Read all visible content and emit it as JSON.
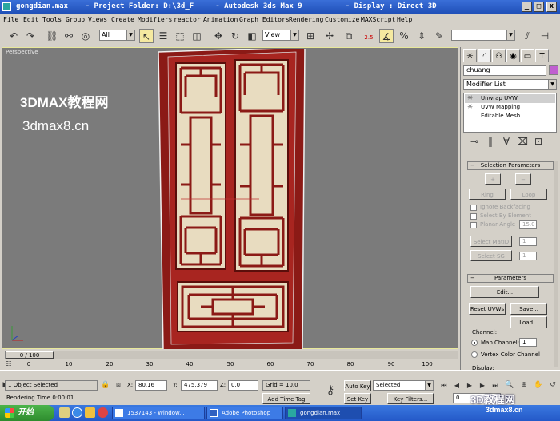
{
  "window": {
    "title": "gongdian.max    - Project Folder: D:\\3d_F     - Autodesk 3ds Max 9          - Display : Direct 3D",
    "min_glyph": "_",
    "max_glyph": "□",
    "close_glyph": "x"
  },
  "menu": [
    "File",
    "Edit",
    "Tools",
    "Group",
    "Views",
    "Create",
    "Modifiers",
    "reactor",
    "Animation",
    "Graph Editors",
    "Rendering",
    "Customize",
    "MAXScript",
    "Help"
  ],
  "toolbar": {
    "selection_filter": "All",
    "reference_coord": "View",
    "snap_value": "2.5"
  },
  "viewport": {
    "label": "Perspective",
    "watermark_title": "3DMAX教程网",
    "watermark_url": "3dmax8.cn"
  },
  "command_panel": {
    "object_name": "chuang",
    "modifier_list": "Modifier List",
    "stack": [
      "Unwrap UVW",
      "UVW Mapping",
      "Editable Mesh"
    ],
    "selection_rollout": "Selection Parameters",
    "ring_label": "Ring",
    "loop_label": "Loop",
    "ignore_backfacing": "Ignore Backfacing",
    "select_by_element": "Select By Element",
    "planar_angle": "Planar Angle",
    "planar_angle_value": "15.0",
    "select_matid": "Select MatID",
    "select_sg": "Select SG",
    "matid_value": "1",
    "sg_value": "1",
    "parameters_rollout": "Parameters",
    "edit_button": "Edit...",
    "reset_uvws": "Reset UVWs",
    "save_button": "Save...",
    "load_button": "Load...",
    "channel_label": "Channel:",
    "map_channel": "Map Channel:",
    "map_channel_value": "1",
    "vertex_color_channel": "Vertex Color Channel",
    "display_label": "Display:"
  },
  "timeline": {
    "slider_label": "0 / 100",
    "ticks": [
      "0",
      "10",
      "20",
      "30",
      "40",
      "50",
      "60",
      "70",
      "80",
      "90",
      "100"
    ]
  },
  "status": {
    "selected": "1 Object Selected",
    "rendering_time": "Rendering Time  0:00:01",
    "x_label": "X:",
    "x_value": "80.16",
    "y_label": "Y:",
    "y_value": "475.379",
    "z_label": "Z:",
    "z_value": "0.0",
    "grid": "Grid = 10.0",
    "add_time_tag": "Add Time Tag",
    "auto_key": "Auto Key",
    "set_key": "Set Key",
    "selected_dropdown": "Selected",
    "key_filters": "Key Filters...",
    "frame_value": "0"
  },
  "taskbar": {
    "start": "开始",
    "tasks": [
      "1537143 - Window...",
      "Adobe Photoshop",
      "gongdian.max"
    ],
    "logo_title": "3D教程网",
    "logo_url": "3dmax8.cn"
  },
  "colors": {
    "door_frame": "#8b1a16",
    "door_panel": "#e8dcc0",
    "viewport_bg": "#7b7b7b",
    "titlebar": "#2a5cc8",
    "taskbar": "#2f66d4"
  }
}
